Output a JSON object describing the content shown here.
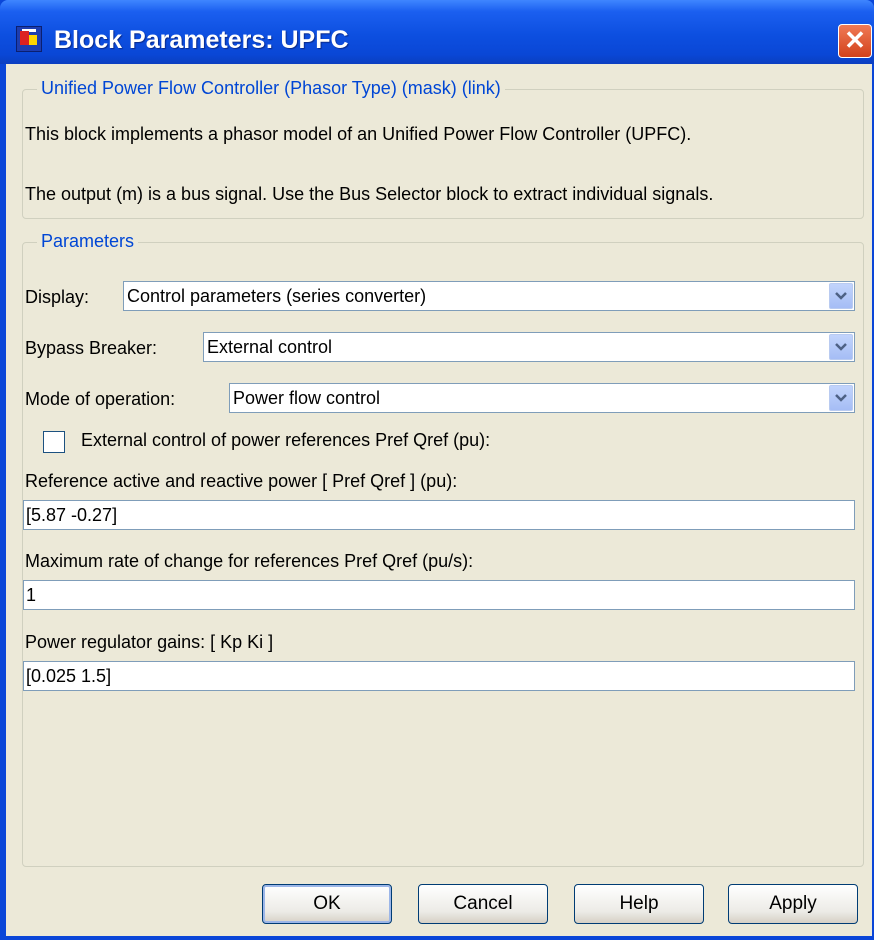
{
  "window": {
    "title": "Block Parameters: UPFC",
    "close_glyph": "✕"
  },
  "description_group": {
    "legend": "Unified Power Flow Controller (Phasor Type) (mask) (link)",
    "line1": "This block implements a phasor model of an Unified Power Flow Controller (UPFC).",
    "line2": "The output (m) is a bus signal. Use the Bus Selector block to extract individual signals."
  },
  "parameters_group": {
    "legend": "Parameters",
    "display": {
      "label": "Display:",
      "value": "Control parameters (series converter)"
    },
    "bypass_breaker": {
      "label": "Bypass Breaker:",
      "value": "External control"
    },
    "mode_of_operation": {
      "label": "Mode of operation:",
      "value": "Power flow control"
    },
    "external_control": {
      "label": "External control of power references Pref  Qref (pu):",
      "checked": false
    },
    "reference_power": {
      "label": "Reference active and reactive power [ Pref  Qref ] (pu):",
      "value": "[5.87 -0.27]"
    },
    "max_rate": {
      "label": "Maximum rate of change for references Pref  Qref (pu/s):",
      "value": "1"
    },
    "regulator_gains": {
      "label": "Power regulator gains: [ Kp  Ki ]",
      "value": "[0.025 1.5]"
    }
  },
  "buttons": {
    "ok": "OK",
    "cancel": "Cancel",
    "help": "Help",
    "apply": "Apply"
  },
  "colors": {
    "titlebar": "#0a47d6",
    "legend_text": "#0046d5",
    "dialog_bg": "#ece9d8",
    "close_button": "#d2421c"
  }
}
